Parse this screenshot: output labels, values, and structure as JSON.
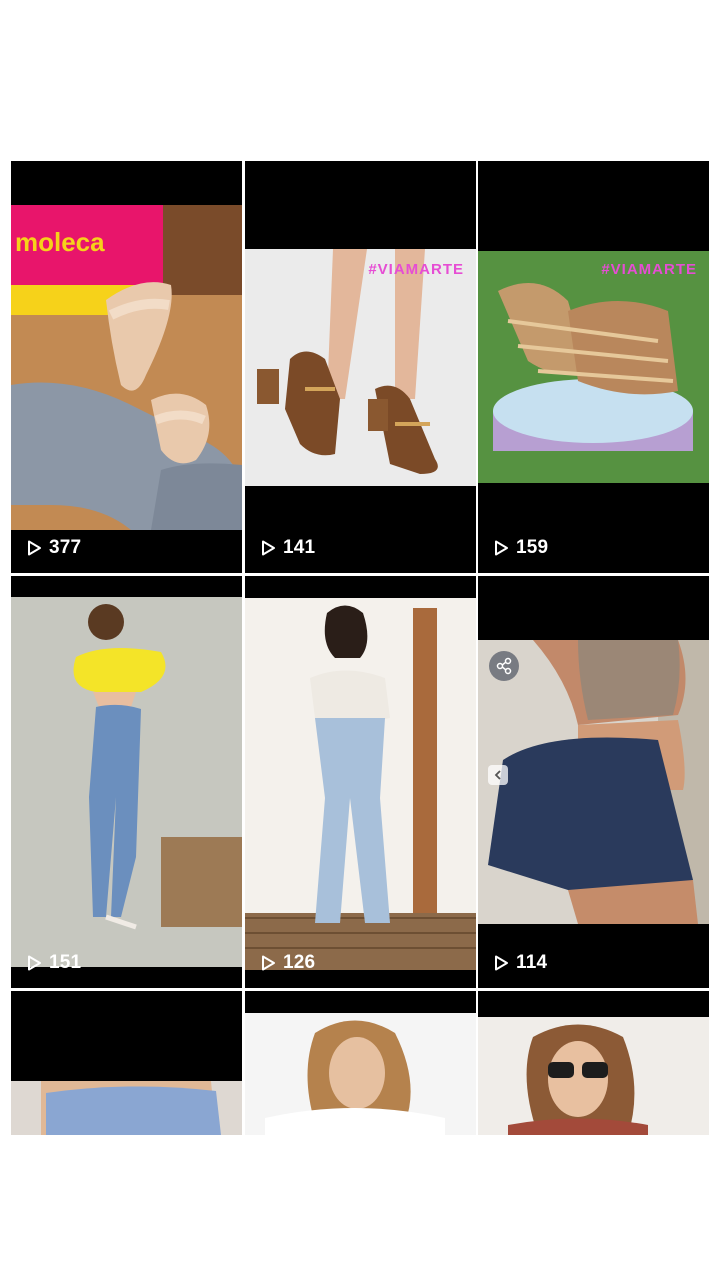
{
  "grid": {
    "tiles": [
      {
        "views": "377",
        "tag": "",
        "brand_box": "moleca",
        "icon": "play-icon"
      },
      {
        "views": "141",
        "tag": "#VIAMARTE",
        "icon": "play-icon"
      },
      {
        "views": "159",
        "tag": "#VIAMARTE",
        "icon": "play-icon"
      },
      {
        "views": "151",
        "tag": "",
        "icon": "play-icon"
      },
      {
        "views": "126",
        "tag": "",
        "icon": "play-icon"
      },
      {
        "views": "114",
        "tag": "",
        "icon": "play-icon",
        "share_icon": "share-icon",
        "prev_icon": "chevron-left-icon"
      },
      {
        "views": "",
        "tag": ""
      },
      {
        "views": "",
        "tag": ""
      },
      {
        "views": "",
        "tag": ""
      }
    ]
  },
  "colors": {
    "background": "#ffffff",
    "tile_black": "#000000",
    "hashtag_pink": "#e64dd4",
    "moleca_pink": "#e8156b",
    "moleca_yellow": "#f6d21a"
  }
}
